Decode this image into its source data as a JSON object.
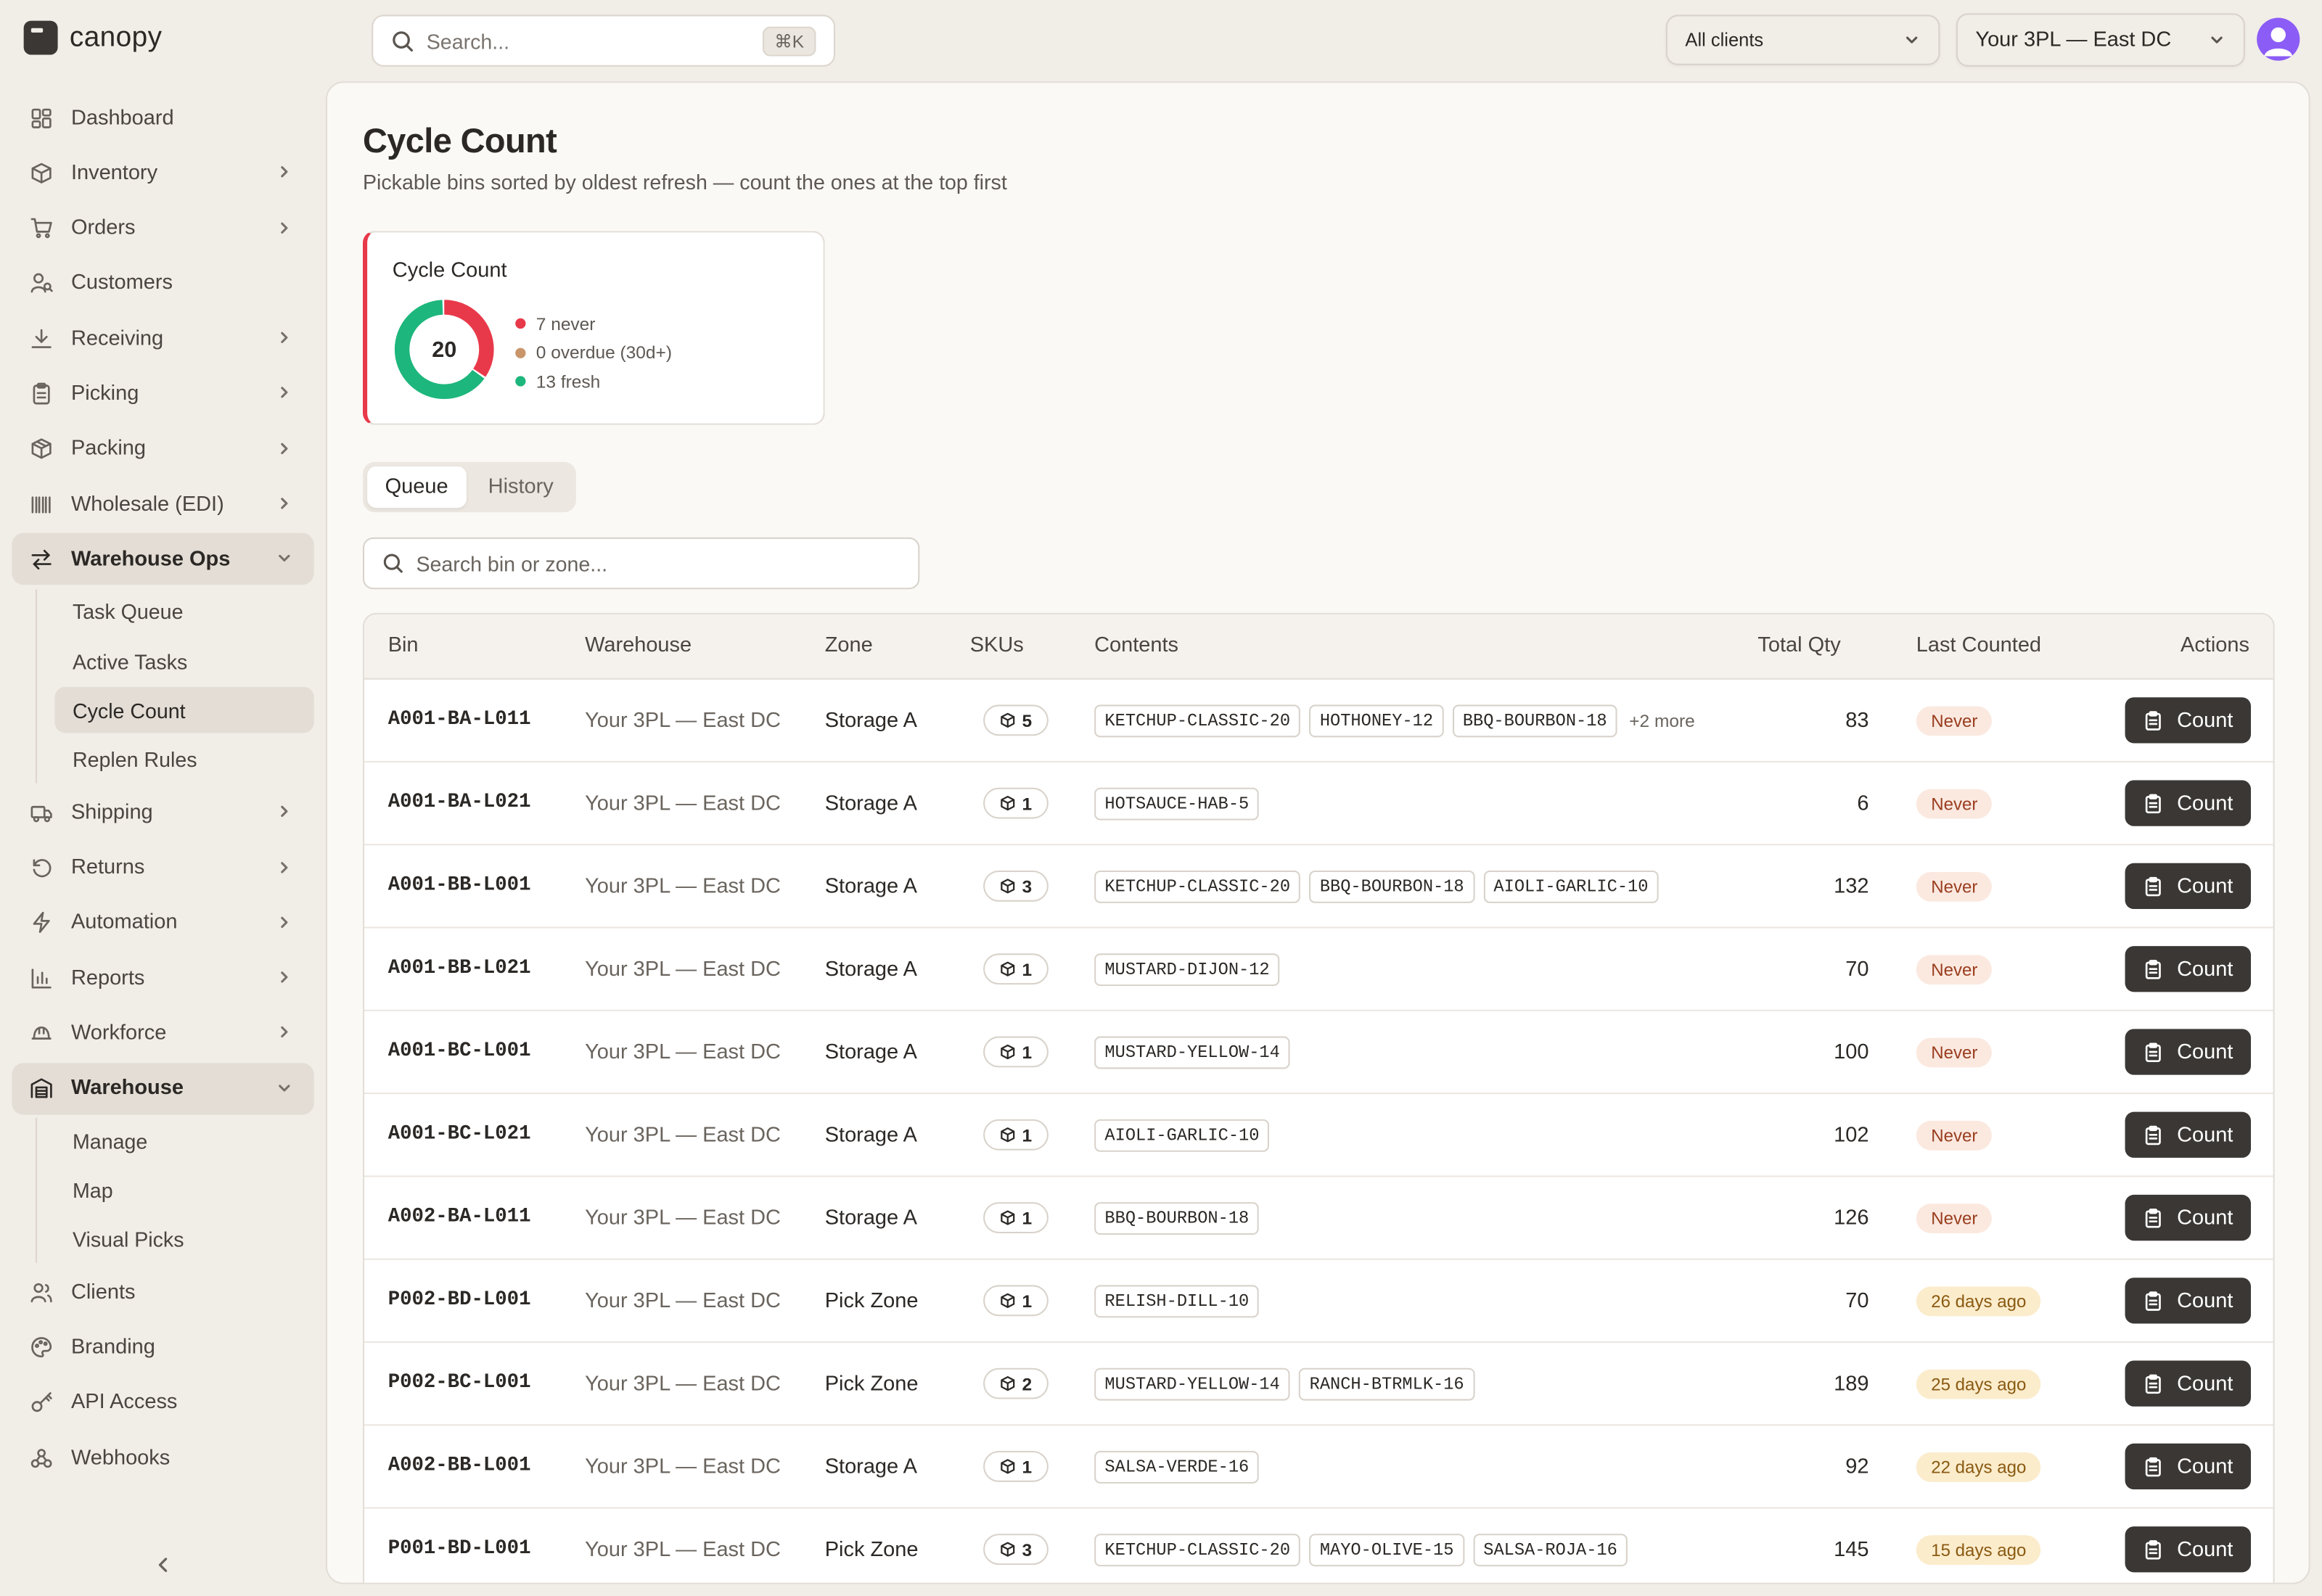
{
  "app": {
    "name": "canopy"
  },
  "topbar": {
    "search_placeholder": "Search...",
    "search_shortcut": "⌘K",
    "client_select": "All clients",
    "warehouse_select": "Your 3PL — East DC"
  },
  "sidebar": {
    "items": [
      {
        "label": "Dashboard",
        "icon": "dashboard-icon",
        "chevron": false
      },
      {
        "label": "Inventory",
        "icon": "box-icon",
        "chevron": true
      },
      {
        "label": "Orders",
        "icon": "cart-icon",
        "chevron": true
      },
      {
        "label": "Customers",
        "icon": "customers-icon",
        "chevron": false
      },
      {
        "label": "Receiving",
        "icon": "download-icon",
        "chevron": true
      },
      {
        "label": "Picking",
        "icon": "clipboard-icon",
        "chevron": true
      },
      {
        "label": "Packing",
        "icon": "package-icon",
        "chevron": true
      },
      {
        "label": "Wholesale (EDI)",
        "icon": "barcode-icon",
        "chevron": true
      },
      {
        "label": "Warehouse Ops",
        "icon": "swap-icon",
        "chevron": true,
        "expanded": true,
        "children": [
          "Task Queue",
          "Active Tasks",
          "Cycle Count",
          "Replen Rules"
        ],
        "active_child": 2
      },
      {
        "label": "Shipping",
        "icon": "truck-icon",
        "chevron": true
      },
      {
        "label": "Returns",
        "icon": "return-icon",
        "chevron": true
      },
      {
        "label": "Automation",
        "icon": "bolt-icon",
        "chevron": true
      },
      {
        "label": "Reports",
        "icon": "bar-chart-icon",
        "chevron": true
      },
      {
        "label": "Workforce",
        "icon": "hardhat-icon",
        "chevron": true
      },
      {
        "label": "Warehouse",
        "icon": "warehouse-icon",
        "chevron": true,
        "expanded": true,
        "children": [
          "Manage",
          "Map",
          "Visual Picks"
        ]
      },
      {
        "label": "Clients",
        "icon": "users-icon",
        "chevron": false
      },
      {
        "label": "Branding",
        "icon": "palette-icon",
        "chevron": false
      },
      {
        "label": "API Access",
        "icon": "key-icon",
        "chevron": false
      },
      {
        "label": "Webhooks",
        "icon": "webhook-icon",
        "chevron": false
      }
    ]
  },
  "page": {
    "title": "Cycle Count",
    "subtitle": "Pickable bins sorted by oldest refresh — count the ones at the top first"
  },
  "summary": {
    "title": "Cycle Count",
    "total": "20",
    "never": 7,
    "overdue": 0,
    "fresh": 13,
    "never_label": "7 never",
    "overdue_label": "0 overdue (30d+)",
    "fresh_label": "13 fresh",
    "colors": {
      "never": "#e8394a",
      "overdue": "#c9956b",
      "fresh": "#1db67c"
    }
  },
  "tabs": [
    {
      "label": "Queue",
      "active": true
    },
    {
      "label": "History",
      "active": false
    }
  ],
  "bin_search": {
    "placeholder": "Search bin or zone..."
  },
  "table": {
    "headers": [
      "Bin",
      "Warehouse",
      "Zone",
      "SKUs",
      "Contents",
      "Total Qty",
      "Last Counted",
      "Actions"
    ],
    "action_label": "Count",
    "rows": [
      {
        "bin": "A001-BA-L011",
        "warehouse": "Your 3PL — East DC",
        "zone": "Storage A",
        "skus": "5",
        "contents": [
          "KETCHUP-CLASSIC-20",
          "HOTHONEY-12",
          "BBQ-BOURBON-18"
        ],
        "more": "+2 more",
        "qty": "83",
        "last": "Never",
        "status": "never"
      },
      {
        "bin": "A001-BA-L021",
        "warehouse": "Your 3PL — East DC",
        "zone": "Storage A",
        "skus": "1",
        "contents": [
          "HOTSAUCE-HAB-5"
        ],
        "more": "",
        "qty": "6",
        "last": "Never",
        "status": "never"
      },
      {
        "bin": "A001-BB-L001",
        "warehouse": "Your 3PL — East DC",
        "zone": "Storage A",
        "skus": "3",
        "contents": [
          "KETCHUP-CLASSIC-20",
          "BBQ-BOURBON-18",
          "AIOLI-GARLIC-10"
        ],
        "more": "",
        "qty": "132",
        "last": "Never",
        "status": "never"
      },
      {
        "bin": "A001-BB-L021",
        "warehouse": "Your 3PL — East DC",
        "zone": "Storage A",
        "skus": "1",
        "contents": [
          "MUSTARD-DIJON-12"
        ],
        "more": "",
        "qty": "70",
        "last": "Never",
        "status": "never"
      },
      {
        "bin": "A001-BC-L001",
        "warehouse": "Your 3PL — East DC",
        "zone": "Storage A",
        "skus": "1",
        "contents": [
          "MUSTARD-YELLOW-14"
        ],
        "more": "",
        "qty": "100",
        "last": "Never",
        "status": "never"
      },
      {
        "bin": "A001-BC-L021",
        "warehouse": "Your 3PL — East DC",
        "zone": "Storage A",
        "skus": "1",
        "contents": [
          "AIOLI-GARLIC-10"
        ],
        "more": "",
        "qty": "102",
        "last": "Never",
        "status": "never"
      },
      {
        "bin": "A002-BA-L011",
        "warehouse": "Your 3PL — East DC",
        "zone": "Storage A",
        "skus": "1",
        "contents": [
          "BBQ-BOURBON-18"
        ],
        "more": "",
        "qty": "126",
        "last": "Never",
        "status": "never"
      },
      {
        "bin": "P002-BD-L001",
        "warehouse": "Your 3PL — East DC",
        "zone": "Pick Zone",
        "skus": "1",
        "contents": [
          "RELISH-DILL-10"
        ],
        "more": "",
        "qty": "70",
        "last": "26 days ago",
        "status": "days"
      },
      {
        "bin": "P002-BC-L001",
        "warehouse": "Your 3PL — East DC",
        "zone": "Pick Zone",
        "skus": "2",
        "contents": [
          "MUSTARD-YELLOW-14",
          "RANCH-BTRMLK-16"
        ],
        "more": "",
        "qty": "189",
        "last": "25 days ago",
        "status": "days"
      },
      {
        "bin": "A002-BB-L001",
        "warehouse": "Your 3PL — East DC",
        "zone": "Storage A",
        "skus": "1",
        "contents": [
          "SALSA-VERDE-16"
        ],
        "more": "",
        "qty": "92",
        "last": "22 days ago",
        "status": "days"
      },
      {
        "bin": "P001-BD-L001",
        "warehouse": "Your 3PL — East DC",
        "zone": "Pick Zone",
        "skus": "3",
        "contents": [
          "KETCHUP-CLASSIC-20",
          "MAYO-OLIVE-15",
          "SALSA-ROJA-16"
        ],
        "more": "",
        "qty": "145",
        "last": "15 days ago",
        "status": "days"
      }
    ]
  }
}
